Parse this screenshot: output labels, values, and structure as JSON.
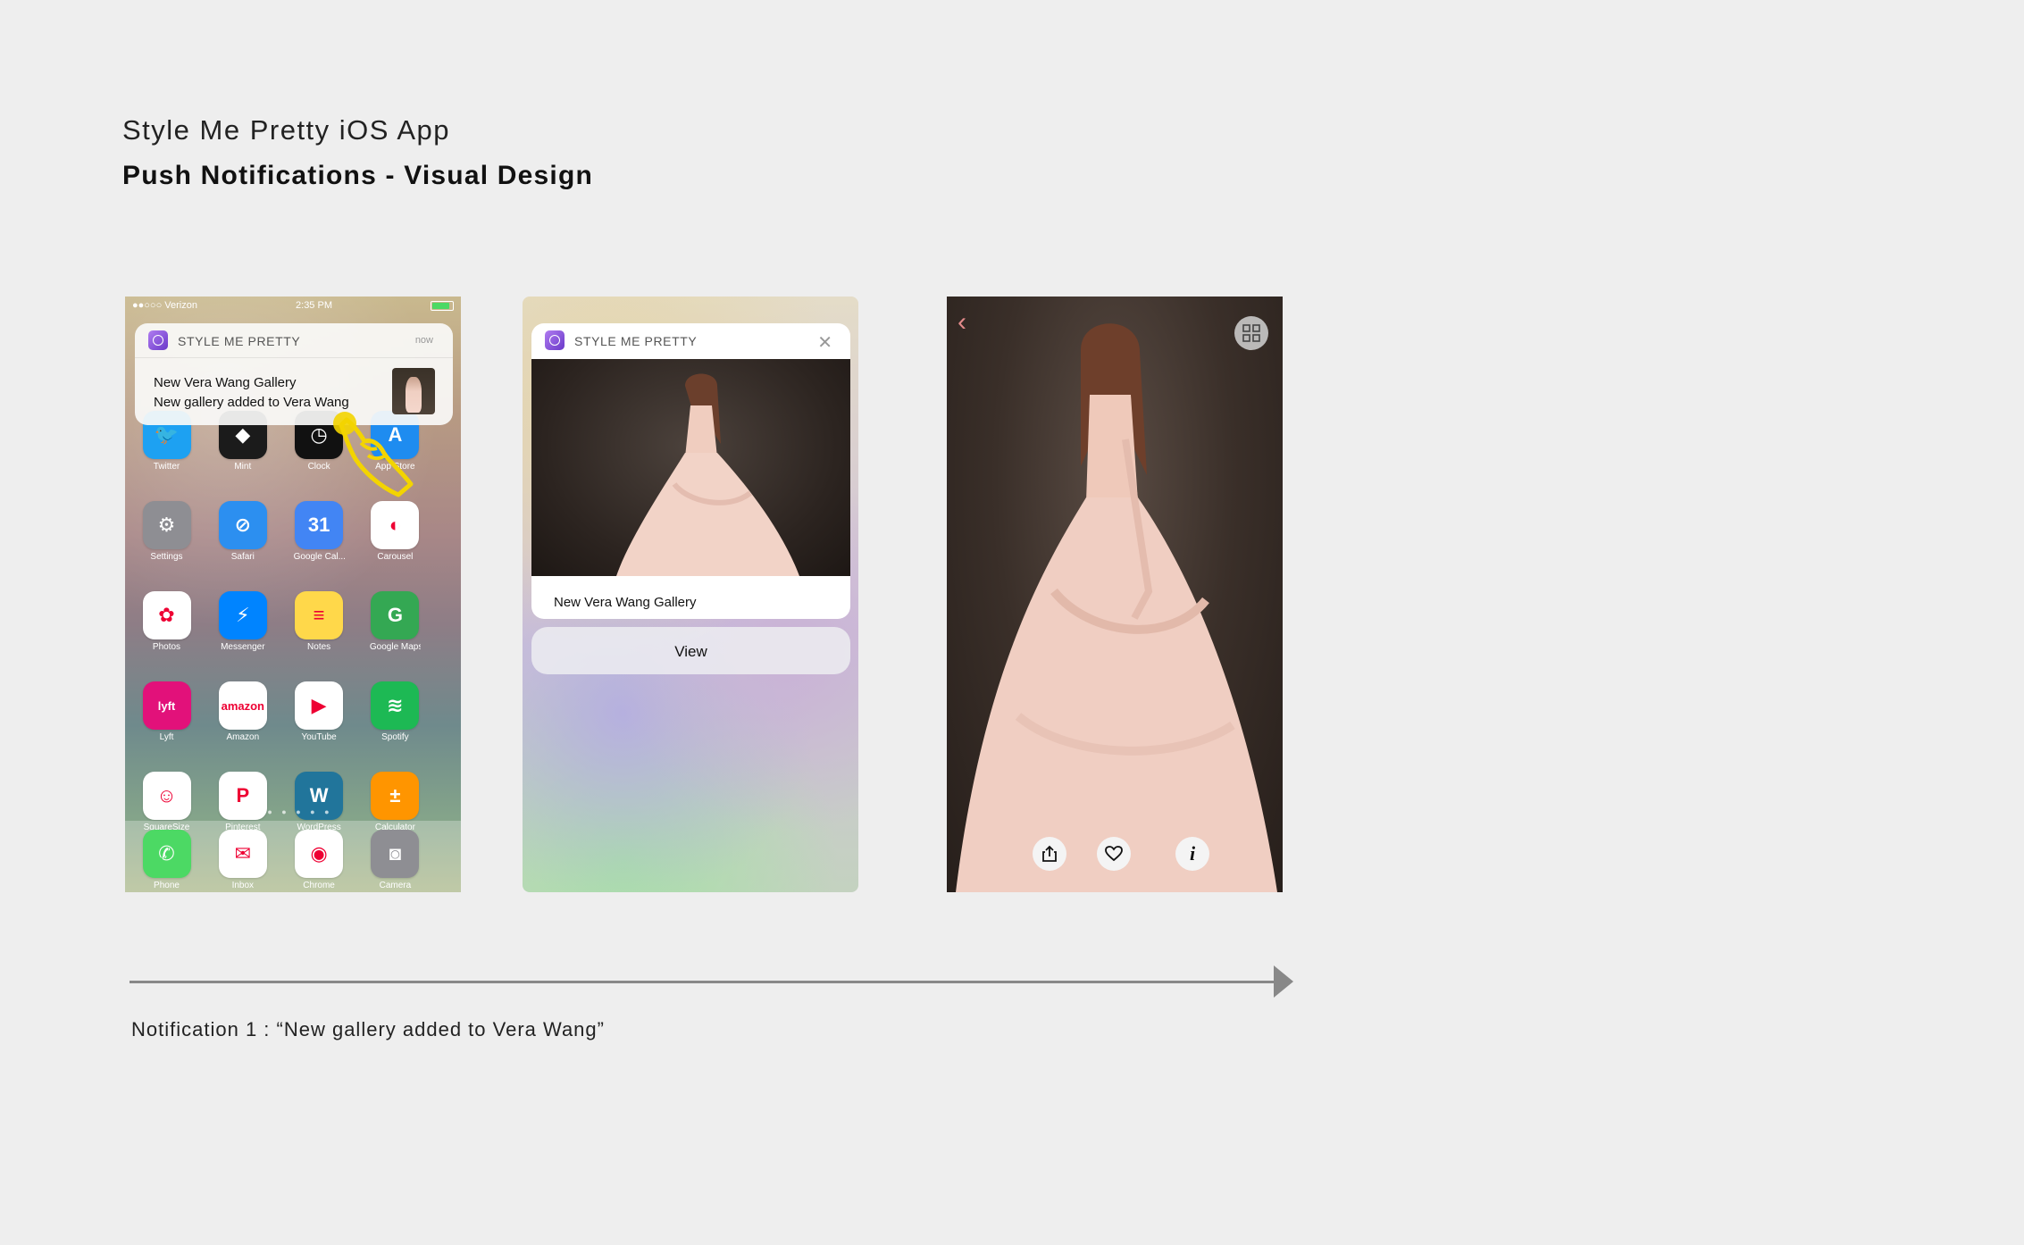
{
  "header": {
    "title": "Style Me Pretty iOS App",
    "subtitle": "Push Notifications - Visual Design"
  },
  "screen1": {
    "status": {
      "carrier": "Verizon",
      "time": "2:35 PM"
    },
    "notification": {
      "app_name": "STYLE ME PRETTY",
      "time": "now",
      "title": "New Vera Wang Gallery",
      "body": "New gallery added to Vera Wang"
    },
    "apps": [
      {
        "label": "Twitter",
        "icon": "twitter-icon",
        "color": "#1da1f2",
        "glyph": "🐦"
      },
      {
        "label": "Mint",
        "icon": "mint-icon",
        "color": "#1b1b1b",
        "glyph": "◆"
      },
      {
        "label": "Clock",
        "icon": "clock-icon",
        "color": "#111111",
        "glyph": "◷"
      },
      {
        "label": "App Store",
        "icon": "app-store-icon",
        "color": "#1e8cf0",
        "glyph": "A"
      },
      {
        "label": "Settings",
        "icon": "settings-icon",
        "color": "#8e8e93",
        "glyph": "⚙"
      },
      {
        "label": "Safari",
        "icon": "safari-icon",
        "color": "#2c8ff0",
        "glyph": "⊘"
      },
      {
        "label": "Google Cal...",
        "icon": "google-calendar-icon",
        "color": "#4285f4",
        "glyph": "31"
      },
      {
        "label": "Carousel",
        "icon": "carousel-icon",
        "color": "#ffffff",
        "glyph": "◐"
      },
      {
        "label": "Photos",
        "icon": "photos-icon",
        "color": "#ffffff",
        "glyph": "✿"
      },
      {
        "label": "Messenger",
        "icon": "messenger-icon",
        "color": "#0084ff",
        "glyph": "⚡"
      },
      {
        "label": "Notes",
        "icon": "notes-icon",
        "color": "#ffd84a",
        "glyph": "≡"
      },
      {
        "label": "Google Maps",
        "icon": "google-maps-icon",
        "color": "#34a853",
        "glyph": "G"
      },
      {
        "label": "Lyft",
        "icon": "lyft-icon",
        "color": "#e2117a",
        "glyph": "lyft"
      },
      {
        "label": "Amazon",
        "icon": "amazon-icon",
        "color": "#ffffff",
        "glyph": "amazon"
      },
      {
        "label": "YouTube",
        "icon": "youtube-icon",
        "color": "#ffffff",
        "glyph": "▶"
      },
      {
        "label": "Spotify",
        "icon": "spotify-icon",
        "color": "#1db954",
        "glyph": "≋"
      },
      {
        "label": "SquareSize",
        "icon": "squaresize-icon",
        "color": "#ffffff",
        "glyph": "☺"
      },
      {
        "label": "Pinterest",
        "icon": "pinterest-icon",
        "color": "#ffffff",
        "glyph": "P"
      },
      {
        "label": "WordPress",
        "icon": "wordpress-icon",
        "color": "#21759b",
        "glyph": "W"
      },
      {
        "label": "Calculator",
        "icon": "calculator-icon",
        "color": "#ff9500",
        "glyph": "±"
      }
    ],
    "dock": [
      {
        "label": "Phone",
        "icon": "phone-icon",
        "color": "#4cd964",
        "glyph": "✆"
      },
      {
        "label": "Inbox",
        "icon": "inbox-icon",
        "color": "#ffffff",
        "glyph": "✉"
      },
      {
        "label": "Chrome",
        "icon": "chrome-icon",
        "color": "#ffffff",
        "glyph": "◉"
      },
      {
        "label": "Camera",
        "icon": "camera-icon",
        "color": "#8e8e93",
        "glyph": "◙"
      }
    ]
  },
  "screen2": {
    "app_name": "STYLE ME PRETTY",
    "caption": "New Vera Wang Gallery",
    "view_label": "View"
  },
  "screen3": {
    "icons": [
      "back-icon",
      "grid-icon",
      "share-icon",
      "heart-icon",
      "info-icon"
    ],
    "accent": "#e28a8a"
  },
  "footer": {
    "caption": "Notification 1 : “New gallery added to Vera Wang”"
  }
}
